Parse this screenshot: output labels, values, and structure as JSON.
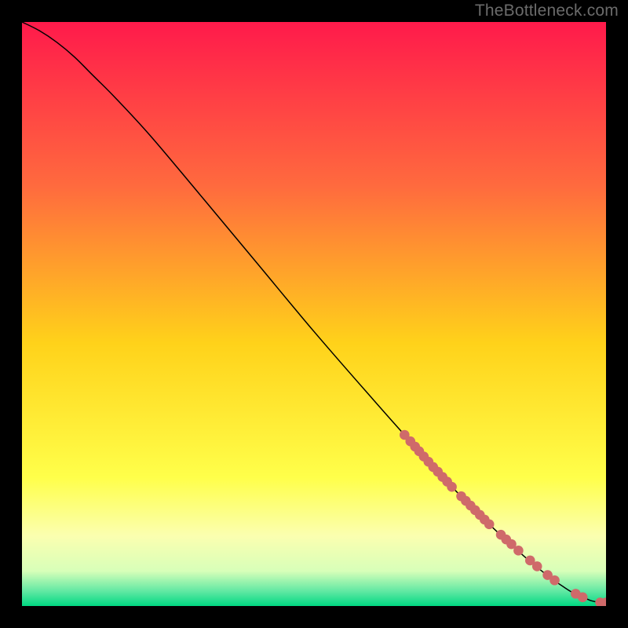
{
  "watermark": "TheBottleneck.com",
  "chart_data": {
    "type": "line",
    "title": "",
    "xlabel": "",
    "ylabel": "",
    "xlim": [
      0,
      100
    ],
    "ylim": [
      0,
      100
    ],
    "grid": false,
    "legend": false,
    "background_gradient": {
      "stops": [
        {
          "offset": 0.0,
          "color": "#ff1a4b"
        },
        {
          "offset": 0.28,
          "color": "#ff6a3e"
        },
        {
          "offset": 0.55,
          "color": "#ffd21a"
        },
        {
          "offset": 0.78,
          "color": "#ffff4a"
        },
        {
          "offset": 0.88,
          "color": "#fbffb0"
        },
        {
          "offset": 0.94,
          "color": "#d8ffb9"
        },
        {
          "offset": 0.975,
          "color": "#60e8a3"
        },
        {
          "offset": 1.0,
          "color": "#00d882"
        }
      ]
    },
    "series": [
      {
        "name": "curve",
        "kind": "line",
        "x": [
          0,
          3,
          6,
          9,
          12,
          16,
          22,
          30,
          40,
          50,
          60,
          68,
          74,
          80,
          86,
          90,
          93,
          95,
          96.5,
          97.5,
          99,
          100
        ],
        "y": [
          100,
          98.5,
          96.5,
          94,
          91,
          87,
          80.5,
          71,
          59,
          47,
          35.5,
          26.5,
          20,
          14,
          8.5,
          5.2,
          3.1,
          1.9,
          1.3,
          0.9,
          0.6,
          0.6
        ]
      },
      {
        "name": "markers",
        "kind": "scatter",
        "x": [
          65.5,
          66.5,
          67.3,
          68.0,
          68.8,
          69.6,
          70.4,
          71.2,
          72.0,
          72.8,
          73.6,
          75.2,
          76.0,
          76.8,
          77.6,
          78.4,
          79.2,
          80.0,
          82.0,
          82.9,
          83.8,
          85.0,
          87.0,
          88.2,
          90.0,
          91.2,
          94.8,
          96.0,
          99.0,
          100.0
        ],
        "y": [
          29.3,
          28.2,
          27.3,
          26.5,
          25.6,
          24.7,
          23.8,
          23.0,
          22.1,
          21.3,
          20.4,
          18.8,
          18.0,
          17.2,
          16.4,
          15.6,
          14.8,
          14.0,
          12.2,
          11.4,
          10.6,
          9.5,
          7.8,
          6.8,
          5.3,
          4.4,
          2.1,
          1.5,
          0.6,
          0.6
        ]
      }
    ]
  }
}
